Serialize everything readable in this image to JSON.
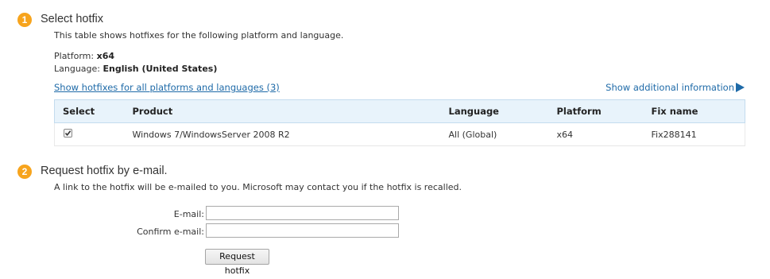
{
  "section1": {
    "step": "1",
    "title": "Select hotfix",
    "description": "This table shows hotfixes for the following platform and language.",
    "platform_label": "Platform: ",
    "platform_value": "x64",
    "language_label": "Language: ",
    "language_value": "English (United States)",
    "show_all_link": "Show hotfixes for all platforms and languages (3)",
    "show_additional_link": "Show additional information",
    "table": {
      "headers": [
        "Select",
        "Product",
        "Language",
        "Platform",
        "Fix name"
      ],
      "rows": [
        {
          "selected": true,
          "product": "Windows 7/WindowsServer 2008 R2",
          "language": "All (Global)",
          "platform": "x64",
          "fix_name": "Fix288141"
        }
      ]
    }
  },
  "section2": {
    "step": "2",
    "title": "Request hotfix by e-mail.",
    "description": "A link to the hotfix will be e-mailed to you. Microsoft may contact you if the hotfix is recalled.",
    "email_label": "E-mail:",
    "email_value": "",
    "confirm_label": "Confirm e-mail:",
    "confirm_value": "",
    "submit_label": "Request hotfix"
  },
  "colors": {
    "step_badge": "#f7a41d",
    "link": "#1e6aa8",
    "table_header_bg": "#e8f3fb"
  }
}
